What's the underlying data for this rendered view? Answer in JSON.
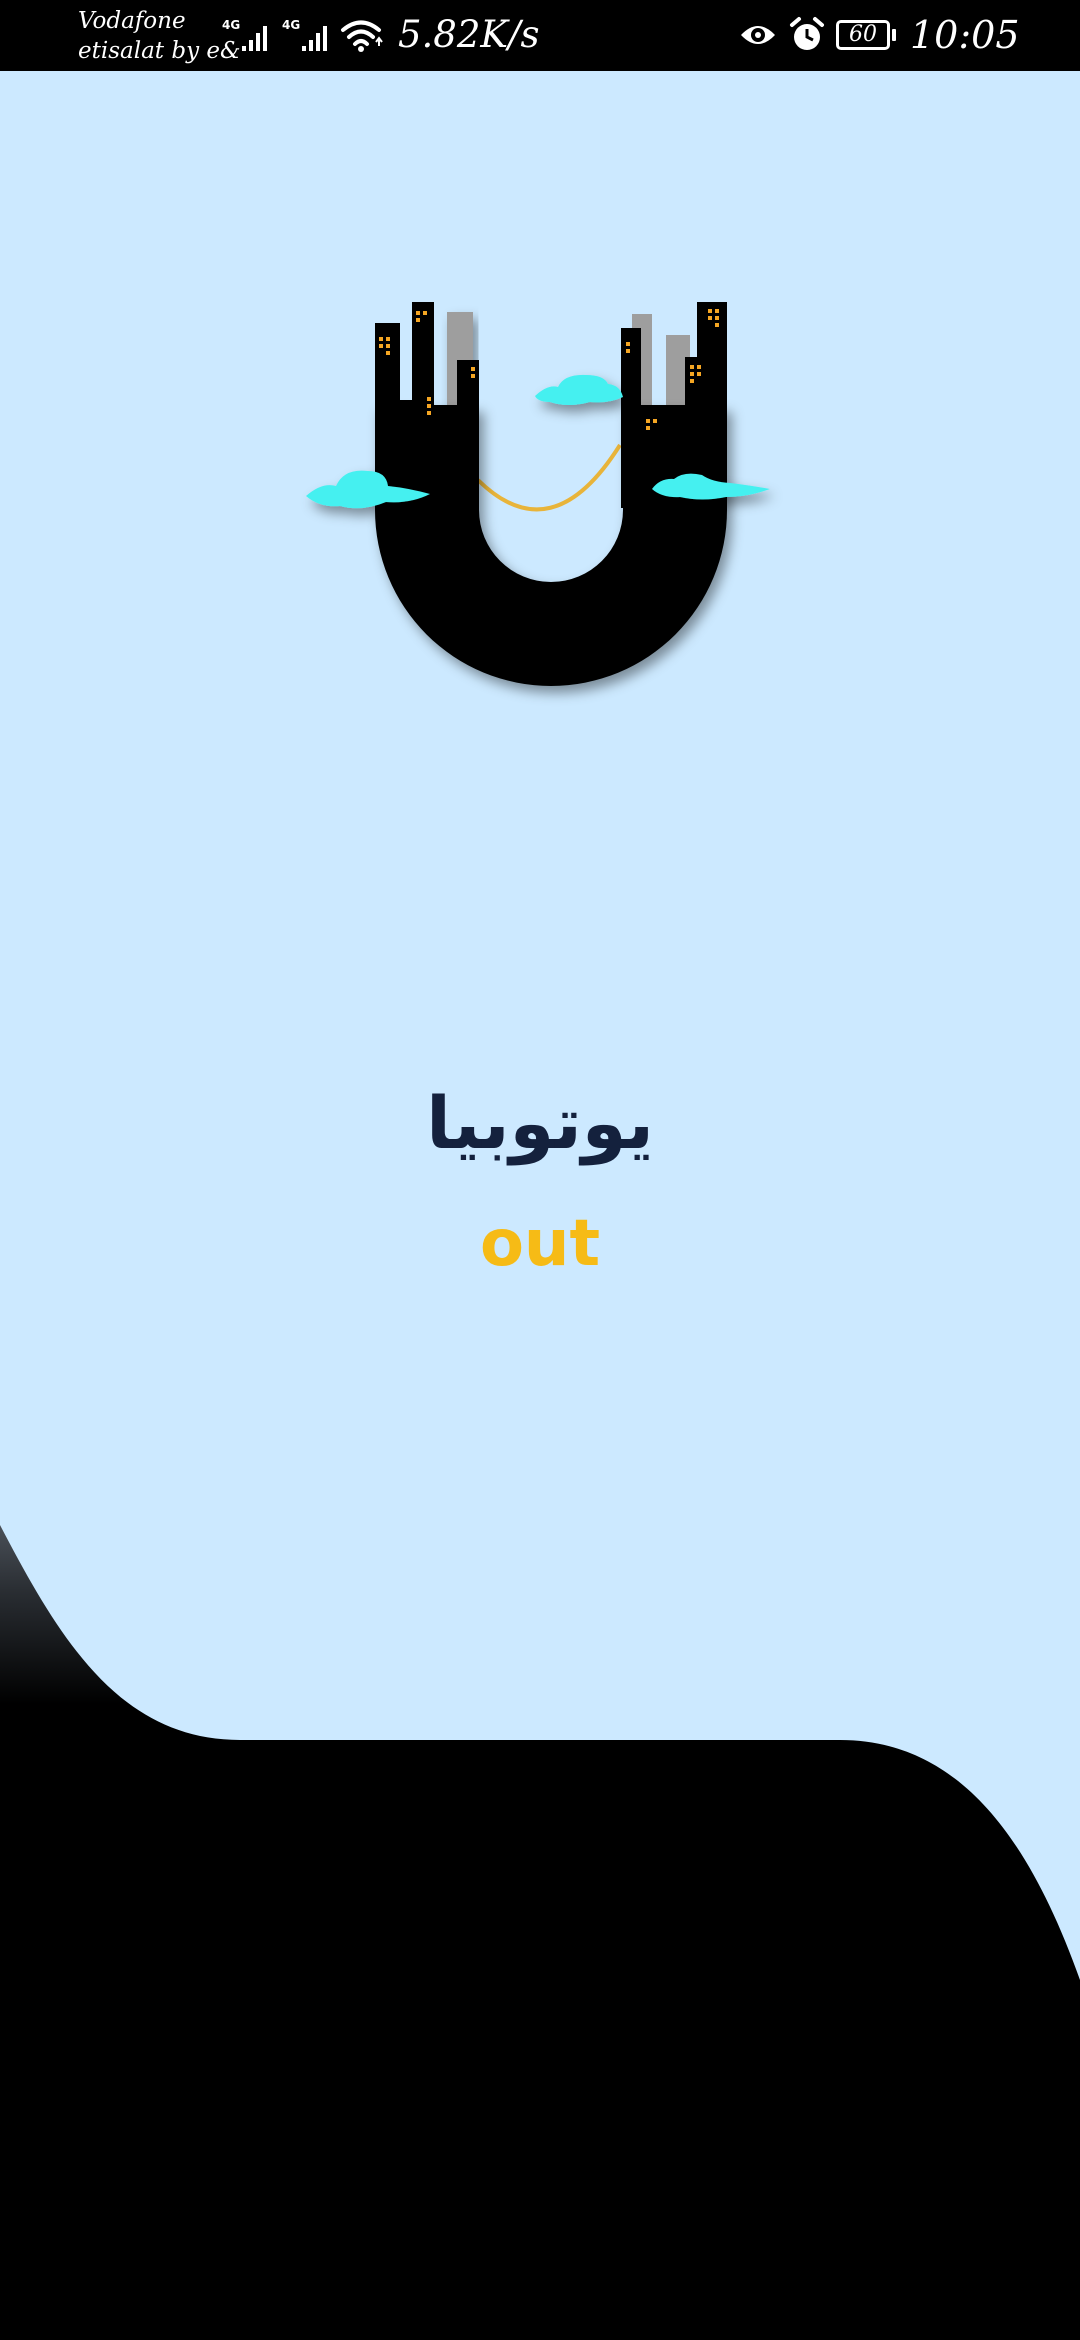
{
  "status_bar": {
    "carrier_line1": "Vodafone",
    "carrier_line2": "etisalat by e&",
    "network_1": "4G",
    "network_2": "4G",
    "speed": "5.82K/s",
    "battery": "60",
    "time": "10:05",
    "icons": [
      "signal-icon",
      "wifi-icon",
      "eye-icon",
      "alarm-icon",
      "battery-icon"
    ]
  },
  "splash": {
    "logo_icon": "city-u-logo-icon",
    "title": "يوتوبيا",
    "subtitle": "out"
  },
  "colors": {
    "background": "#cce9ff",
    "title": "#14213d",
    "subtitle": "#f6bb16",
    "logo": "#000000",
    "cloud": "#45f0f0",
    "window": "#f5a623"
  }
}
